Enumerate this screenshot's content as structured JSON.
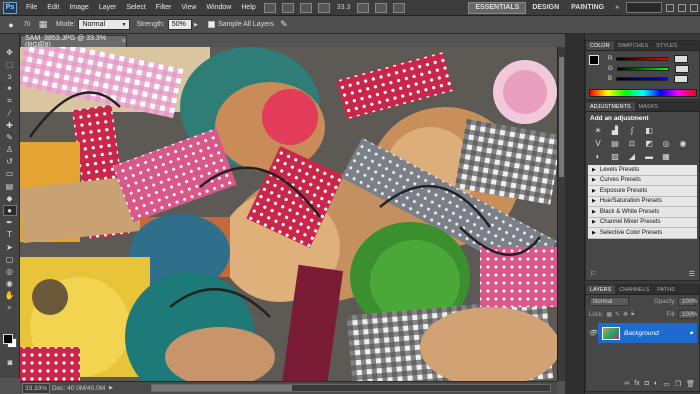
{
  "menubar": {
    "logo": "Ps",
    "items": [
      "File",
      "Edit",
      "Image",
      "Layer",
      "Select",
      "Filter",
      "View",
      "Window",
      "Help"
    ],
    "zoom": "33.3",
    "workspaces": [
      "ESSENTIALS",
      "DESIGN",
      "PAINTING"
    ],
    "more": "»"
  },
  "options": {
    "brush_size": "70",
    "mode_label": "Mode:",
    "mode_value": "Normal",
    "strength_label": "Strength:",
    "strength_value": "50%",
    "sample_all_label": "Sample All Layers"
  },
  "document": {
    "tab_title": "SAM_3853.JPG @ 33.3% (RGB/8)",
    "close": "×"
  },
  "status": {
    "zoom": "33.33%",
    "doc_info": "Doc: 40.0M/40.0M"
  },
  "color_panel": {
    "tabs": [
      "COLOR",
      "SWATCHES",
      "STYLES"
    ],
    "channels": [
      "R",
      "G",
      "B"
    ]
  },
  "adjustments_panel": {
    "tabs": [
      "ADJUSTMENTS",
      "MASKS"
    ],
    "title": "Add an adjustment",
    "presets": [
      "Levels Presets",
      "Curves Presets",
      "Exposure Presets",
      "Hue/Saturation Presets",
      "Black & White Presets",
      "Channel Mixer Presets",
      "Selective Color Presets"
    ]
  },
  "layers_panel": {
    "tabs": [
      "LAYERS",
      "CHANNELS",
      "PATHS"
    ],
    "blend": "Normal",
    "opacity_label": "Opacity:",
    "opacity_value": "100%",
    "lock_label": "Lock:",
    "fill_label": "Fill:",
    "fill_value": "100%",
    "layer_name": "Background"
  },
  "colors": {
    "accent": "#1e6bd0",
    "chrome": "#535353"
  }
}
